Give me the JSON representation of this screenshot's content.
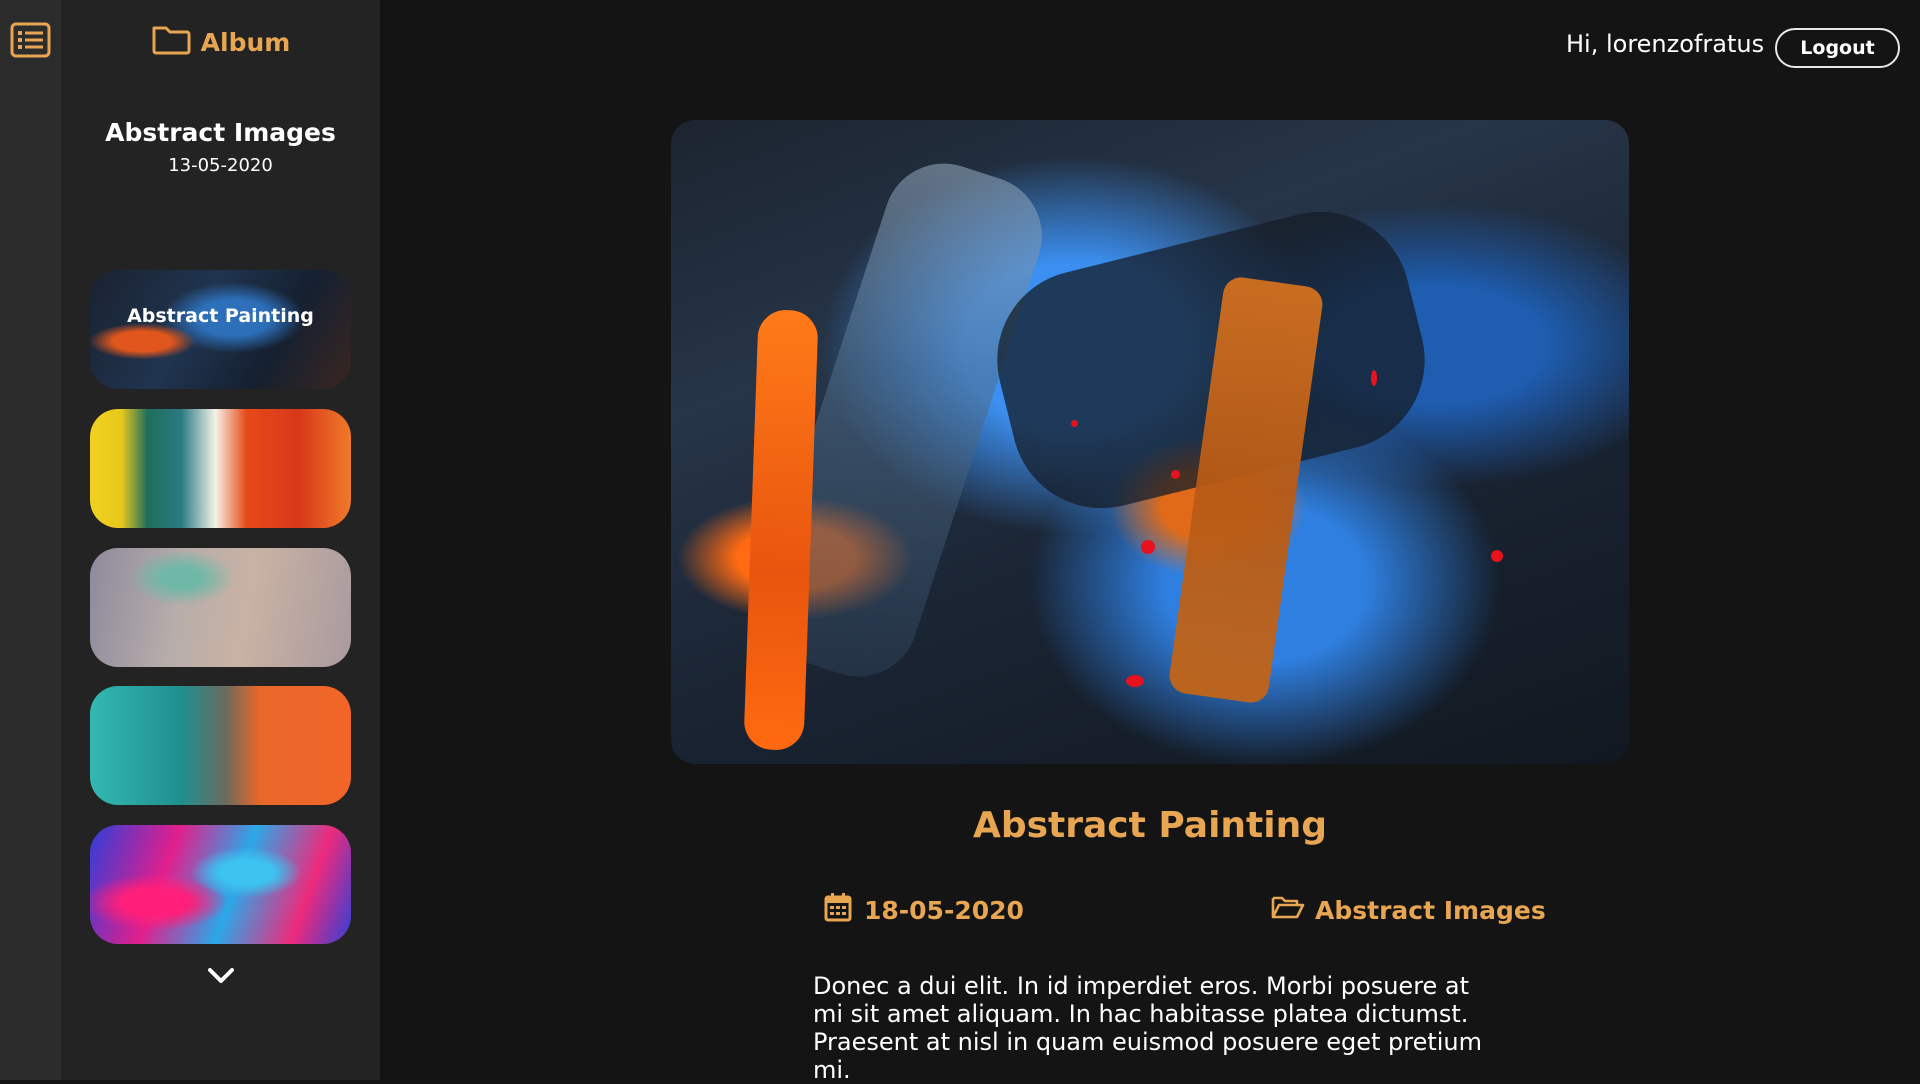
{
  "header": {
    "album_label": "Album",
    "greeting": "Hi, lorenzofratus",
    "logout_label": "Logout"
  },
  "sidebar": {
    "album_name": "Abstract Images",
    "album_date": "13-05-2020",
    "thumbnails": [
      {
        "label": "Abstract Painting",
        "selected": true
      },
      {
        "label": ""
      },
      {
        "label": ""
      },
      {
        "label": ""
      },
      {
        "label": ""
      }
    ]
  },
  "photo": {
    "title": "Abstract Painting",
    "date": "18-05-2020",
    "album": "Abstract Images",
    "description": "Donec a dui elit. In id imperdiet eros. Morbi posuere at mi sit amet aliquam. In hac habitasse platea dictumst. Praesent at nisl in quam euismod posuere eget pretium mi."
  },
  "icons": {
    "menu": "list-icon",
    "album": "folder-icon",
    "date": "calendar-icon",
    "photo_album": "folder-open-icon",
    "scroll": "chevron-down-icon"
  },
  "colors": {
    "accent": "#e8a552",
    "background": "#141414",
    "sidebar": "#232323",
    "rail": "#2c2c2c"
  }
}
